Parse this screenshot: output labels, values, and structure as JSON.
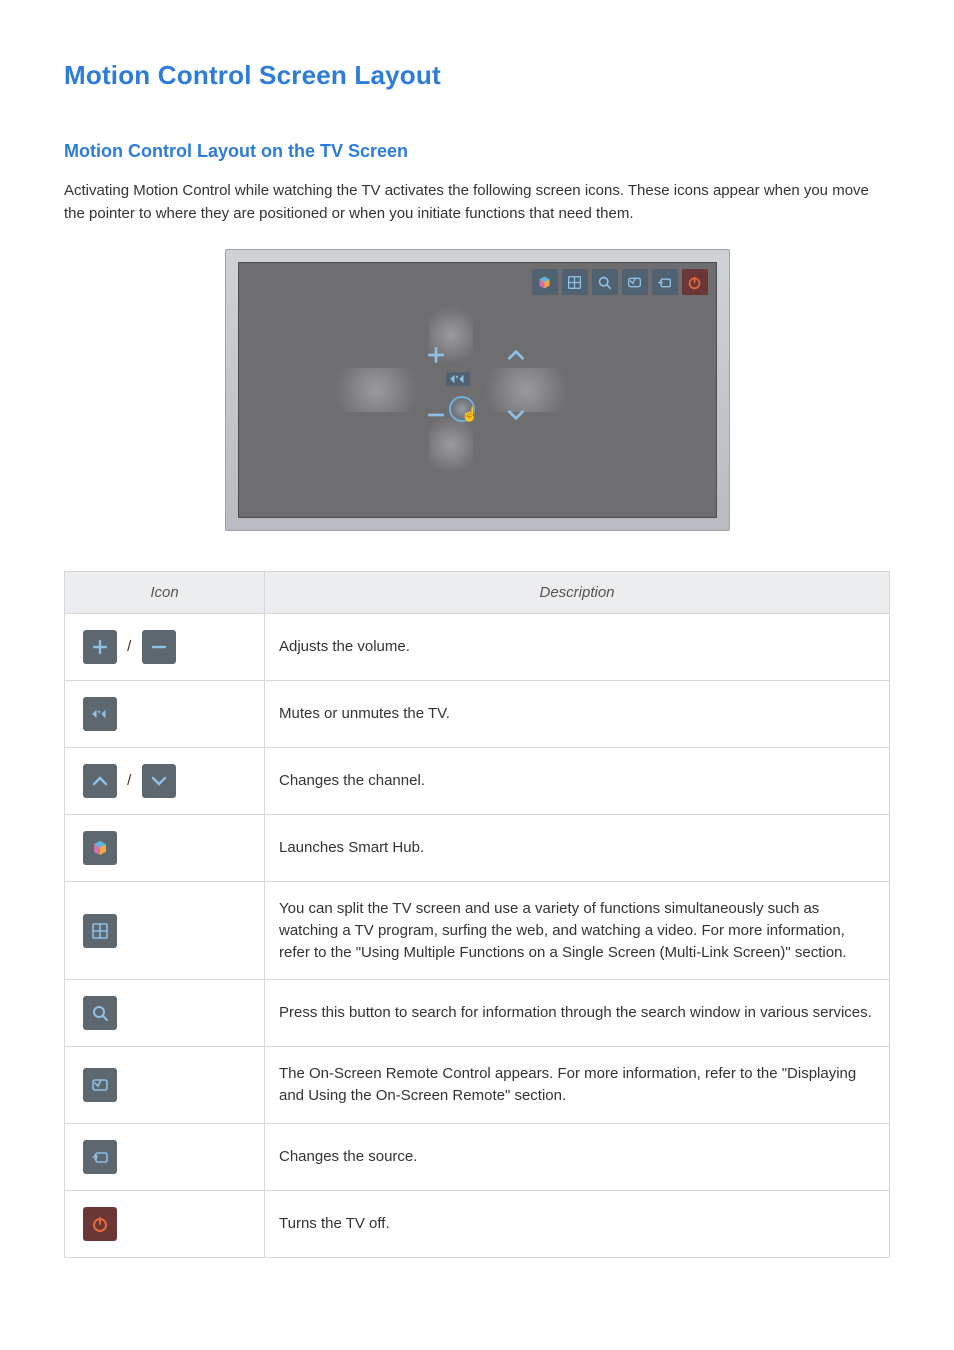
{
  "title": "Motion Control Screen Layout",
  "subtitle": "Motion Control Layout on the TV Screen",
  "intro": "Activating Motion Control while watching the TV activates the following screen icons. These icons appear when you move the pointer to where they are positioned or when you initiate functions that need them.",
  "table": {
    "headers": {
      "icon": "Icon",
      "desc": "Description"
    },
    "sep": "/",
    "rows": [
      {
        "desc": "Adjusts the volume."
      },
      {
        "desc": "Mutes or unmutes the TV."
      },
      {
        "desc": "Changes the channel."
      },
      {
        "desc": "Launches Smart Hub."
      },
      {
        "desc": "You can split the TV screen and use a variety of functions simultaneously such as watching a TV program, surfing the web, and watching a video. For more information, refer to the \"Using Multiple Functions on a Single Screen (Multi-Link Screen)\" section."
      },
      {
        "desc": "Press this button to search for information through the search window in various services."
      },
      {
        "desc": "The On-Screen Remote Control appears. For more information, refer to the \"Displaying and Using the On-Screen Remote\" section."
      },
      {
        "desc": "Changes the source."
      },
      {
        "desc": "Turns the TV off."
      }
    ]
  }
}
